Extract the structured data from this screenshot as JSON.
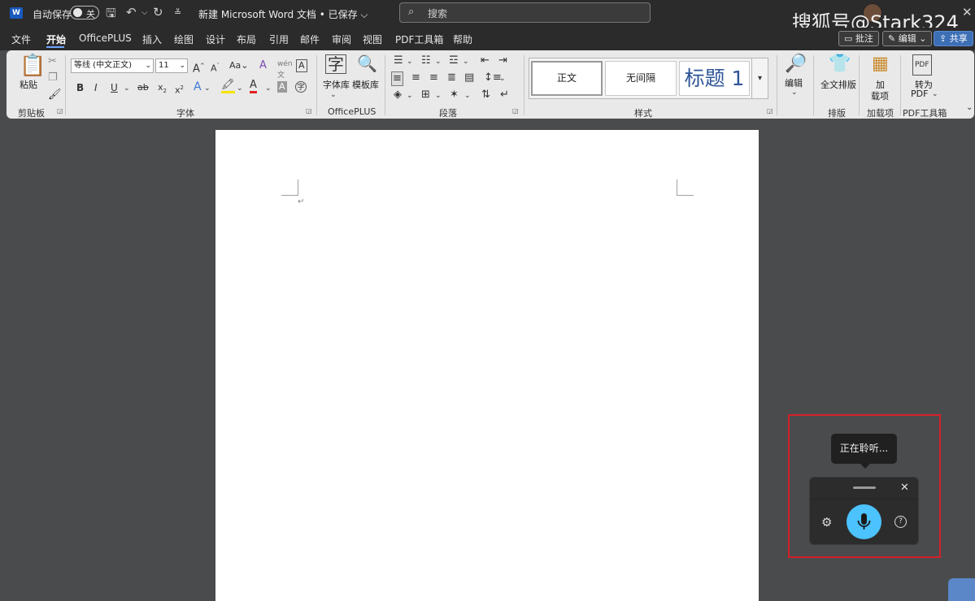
{
  "titlebar": {
    "autosave_label": "自动保存",
    "autosave_state": "关",
    "doc_title": "新建 Microsoft Word 文档 • 已保存 ⌵",
    "search_placeholder": "搜索",
    "watermark": "搜狐号@Stark324"
  },
  "tabs": [
    "文件",
    "开始",
    "OfficePLUS",
    "插入",
    "绘图",
    "设计",
    "布局",
    "引用",
    "邮件",
    "审阅",
    "视图",
    "PDF工具箱",
    "帮助"
  ],
  "active_tab": "开始",
  "right_buttons": {
    "comments": "批注",
    "editing": "编辑",
    "share": "共享"
  },
  "ribbon": {
    "clipboard": {
      "paste": "粘贴",
      "label": "剪贴板"
    },
    "font": {
      "font_name": "等线 (中文正文)",
      "font_size": "11",
      "label": "字体"
    },
    "officeplus": {
      "fontlib": "字体库",
      "templates": "模板库",
      "label": "OfficePLUS"
    },
    "paragraph": {
      "label": "段落"
    },
    "styles": {
      "normal": "正文",
      "no_spacing": "无间隔",
      "heading1": "标题 1",
      "label": "样式"
    },
    "editing": {
      "edit": "编辑"
    },
    "layout": {
      "fulltext": "全文排版",
      "label": "排版"
    },
    "addins": {
      "add": "加",
      "load": "载项",
      "label": "加载项"
    },
    "pdf": {
      "convert": "转为",
      "pdf": "PDF",
      "label": "PDF工具箱"
    }
  },
  "voice": {
    "status": "正在聆听...",
    "mic_color": "#4cc2ff"
  },
  "colors": {
    "accent": "#185abd",
    "highlight_box": "#d4202a"
  }
}
